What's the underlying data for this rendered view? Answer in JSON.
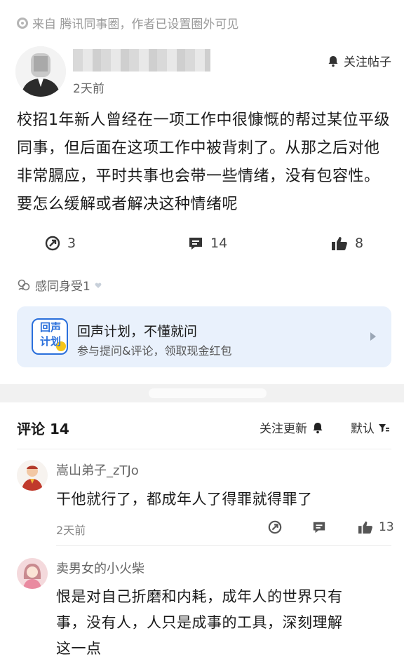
{
  "source": {
    "text": "来自 腾讯同事圈，作者已设置圈外可见"
  },
  "post": {
    "time": "2天前",
    "follow_label": "关注帖子",
    "body": "校招1年新人曾经在一项工作中很慷慨的帮过某位平级同事，但后面在这项工作中被背刺了。从那之后对他非常膈应，平时共事也会带一些情绪，没有包容性。要怎么缓解或者解决这种情绪呢",
    "share_count": "3",
    "comment_count": "14",
    "like_count": "8",
    "resonate": "感同身受1"
  },
  "banner": {
    "logo_text_1": "回声",
    "logo_text_2": "计划",
    "title": "回声计划，不懂就问",
    "subtitle": "参与提问&评论，领取现金红包"
  },
  "comments_header": {
    "title": "评论 14",
    "follow_updates": "关注更新",
    "sort": "默认"
  },
  "comments": [
    {
      "name": "嵩山弟子_zTJo",
      "text": "干他就行了，都成年人了得罪就得罪了",
      "time": "2天前",
      "like_count": "13"
    },
    {
      "name": "卖男女的小火柴",
      "text_line1": "恨是对自己折磨和内耗，成年人的世界只有",
      "text_line2": "事，没有人，人只是成事的工具，深刻理解",
      "text_line3": "这一点"
    }
  ],
  "colors": {
    "banner_bg": "#e9f1fc",
    "accent_yellow": "#f5c518",
    "accent_blue": "#2a6fdb"
  }
}
